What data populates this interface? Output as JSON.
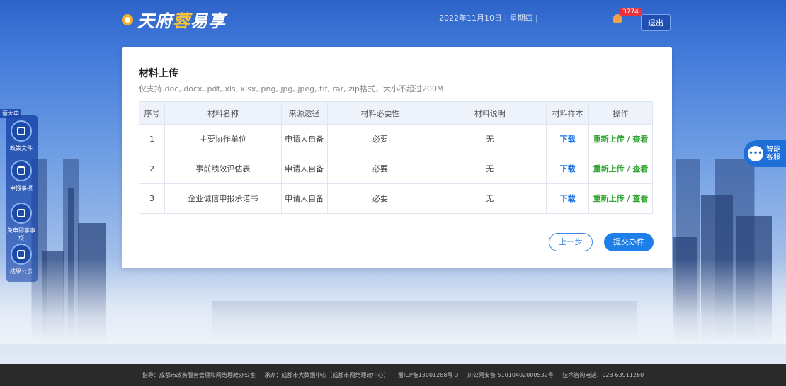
{
  "header": {
    "logo_part1": "天府",
    "logo_part2": "蓉",
    "logo_part3": "易享",
    "date": "2022年11月10日 | 星期四 |",
    "notification_count": "3774",
    "logout_label": "退出"
  },
  "main": {
    "title": "材料上传",
    "subtitle": "仅支持.doc,.docx,.pdf,.xls,.xlsx,.png,.jpg,.jpeg,.tif,.rar,.zip格式，大小不超过200M",
    "columns": [
      "序号",
      "材料名称",
      "来源途径",
      "材料必要性",
      "材料说明",
      "材料样本",
      "操作"
    ],
    "rows": [
      {
        "no": "1",
        "name": "主要协作单位",
        "source": "申请人自备",
        "required": "必要",
        "desc": "无",
        "sample": "下载",
        "action": "重新上传 / 查看"
      },
      {
        "no": "2",
        "name": "事前绩效评估表",
        "source": "申请人自备",
        "required": "必要",
        "desc": "无",
        "sample": "下载",
        "action": "重新上传 / 查看"
      },
      {
        "no": "3",
        "name": "企业诚信申报承诺书",
        "source": "申请人自备",
        "required": "必要",
        "desc": "无",
        "sample": "下载",
        "action": "重新上传 / 查看"
      }
    ],
    "prev_label": "上一步",
    "submit_label": "提交办件"
  },
  "left_nav": {
    "tag": "蓉大申",
    "items": [
      {
        "label": "政策文件",
        "icon": "document-icon"
      },
      {
        "label": "申报事项",
        "icon": "list-icon"
      },
      {
        "label": "免申即享事项",
        "icon": "instant-icon"
      },
      {
        "label": "结果公示",
        "icon": "result-icon"
      }
    ]
  },
  "chat": {
    "label_line1": "智能",
    "label_line2": "客服",
    "icon": "chat-icon"
  },
  "footer": {
    "guide": "指导：成都市政务服务管理和网络理政办公室",
    "host": "承办：成都市大数据中心（成都市网络理政中心）",
    "icp": "蜀ICP备13001288号-3",
    "police": "川公网安备 51010402000532号",
    "hotline": "技术咨询电话：028-63911260"
  },
  "colors": {
    "primary": "#1e7fe8",
    "link_green": "#32a432",
    "logo_accent": "#f6c23a"
  }
}
